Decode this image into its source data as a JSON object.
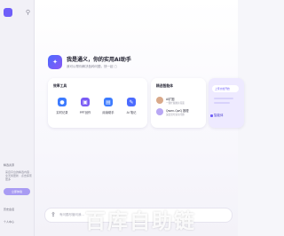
{
  "sidebar": {
    "section_title": "精选资源",
    "description": "来自平台的精选内容 · 全天候更新 · 点击探索更多",
    "cta_label": "立即体验",
    "footer_item_1": "历史会话",
    "footer_item_2": "个人中心"
  },
  "hero": {
    "title": "我是通义，你的实用AI助手",
    "subtitle": "我可以帮你解决各种问题，快一起 ▢"
  },
  "tools_card": {
    "title": "效率工具",
    "items": [
      {
        "label": "实时记录",
        "icon": "microphone-icon",
        "color": "#3d7bff"
      },
      {
        "label": "PPT创作",
        "icon": "presentation-icon",
        "color": "#7a5cf5"
      },
      {
        "label": "阅读助手",
        "icon": "book-icon",
        "color": "#3d7bff"
      },
      {
        "label": "AI 笔记",
        "icon": "note-icon",
        "color": "#4b6bff"
      }
    ]
  },
  "agents_card": {
    "title": "精选智能体",
    "items": [
      {
        "name": "AI扩图",
        "desc": "一键扩展图片画面"
      },
      {
        "name": "Qwen-QwQ 推理",
        "desc": "深度思考复杂问题"
      }
    ]
  },
  "assistant_card": {
    "bubble": "上传文档开始",
    "label": "智能体"
  },
  "input": {
    "placeholder": "有问题尽管问我..."
  },
  "watermark": "百库自助链",
  "colors": {
    "accent": "#6f5ef9",
    "sidebar_bg": "#f2f1f7"
  }
}
